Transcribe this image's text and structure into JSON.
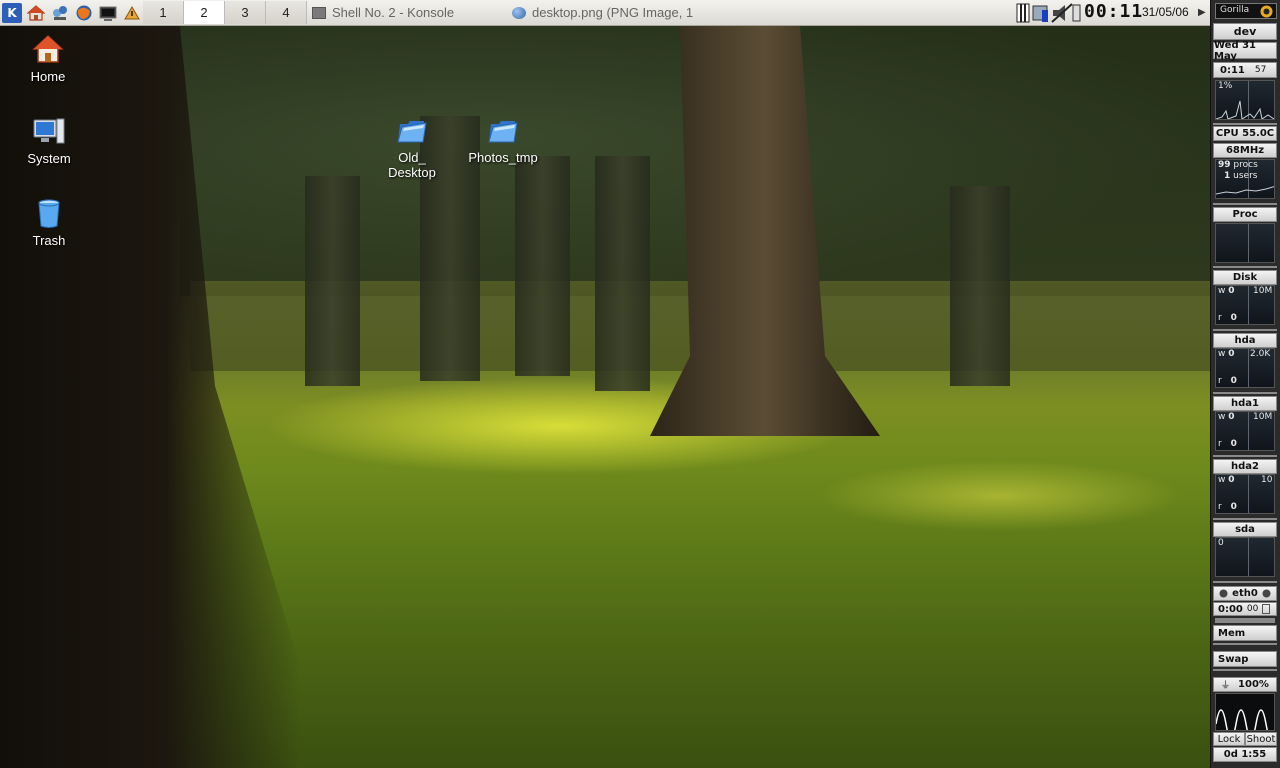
{
  "panel": {
    "launchers": [
      {
        "name": "kmenu",
        "glyph": "K"
      },
      {
        "name": "home",
        "glyph": "⌂"
      },
      {
        "name": "kde-help",
        "glyph": "⚙"
      },
      {
        "name": "firefox",
        "glyph": "●"
      },
      {
        "name": "terminal",
        "glyph": "▣"
      },
      {
        "name": "desktop-share",
        "glyph": "▲"
      }
    ],
    "pager": [
      "1",
      "2",
      "3",
      "4"
    ],
    "active_desktop": "2",
    "tasks": [
      {
        "title": "Shell No. 2 - Konsole",
        "icon": "terminal-icon"
      },
      {
        "title": "desktop.png (PNG Image, 1",
        "icon": "globe-icon"
      }
    ],
    "clock": "00:11",
    "date": "31/05/06"
  },
  "desktop": {
    "icons": [
      {
        "label": "Home",
        "icon": "home-icon"
      },
      {
        "label": "System",
        "icon": "computer-icon"
      },
      {
        "label": "Trash",
        "icon": "trash-icon"
      },
      {
        "label": "Old_\nDesktop",
        "line1": "Old_",
        "line2": "Desktop",
        "icon": "folder-icon"
      },
      {
        "label": "Photos_tmp",
        "icon": "folder-icon"
      }
    ]
  },
  "gkrellm": {
    "theme": "Gorilla",
    "host": "dev",
    "date": "Wed 31 May",
    "uptime_time": "0:11",
    "uptime_seconds": "57",
    "cpu_percent": "1%",
    "cpu_temp": "CPU 55.0C",
    "cpu_freq": "68MHz",
    "procs_count": "99",
    "procs_label": "procs",
    "users_count": "1",
    "users_label": "users",
    "proc_label": "Proc",
    "disk_label": "Disk",
    "disk_scale": "10M",
    "hda_label": "hda",
    "hda_scale": "2.0K",
    "hda1_label": "hda1",
    "hda1_scale": "10M",
    "hda2_label": "hda2",
    "hda2_scale": "10",
    "sda_label": "sda",
    "sda_value": "0",
    "w_label": "w",
    "r_label": "r",
    "zero": "0",
    "net_label": "eth0",
    "net_time": "0:00",
    "net_seconds": "00",
    "mem_label": "Mem",
    "swap_label": "Swap",
    "battery": "100%",
    "lock_label": "Lock",
    "shoot_label": "Shoot",
    "uptime_days": "0d 1:55",
    "colors": {
      "panel_bg": "#dcdad3",
      "gk_bg": "#2b2b2b",
      "folder_blue": "#4a90e8"
    }
  }
}
